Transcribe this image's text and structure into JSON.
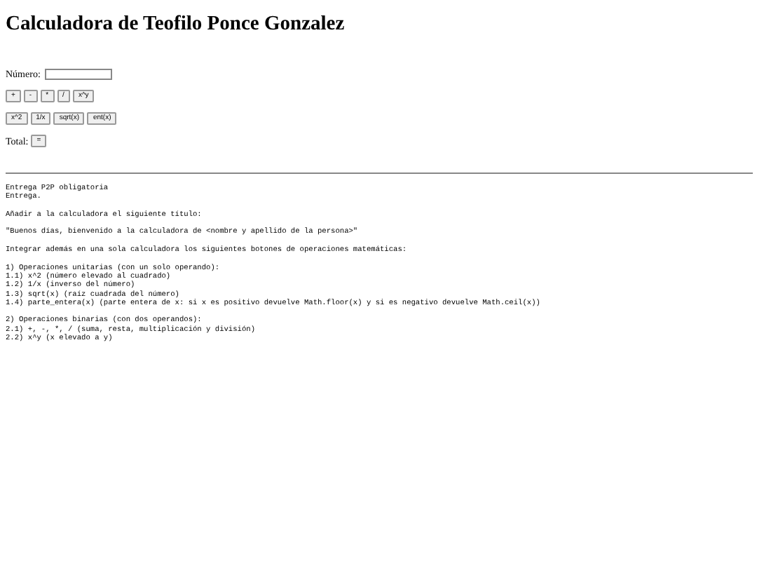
{
  "title": "Calculadora de Teofilo Ponce Gonzalez",
  "number_label": "Número:",
  "binary_buttons": [
    "+",
    "-",
    "*",
    "/",
    "x^y"
  ],
  "unary_buttons": [
    "x^2",
    "1/x",
    "sqrt(x)",
    "ent(x)"
  ],
  "total_label": "Total:",
  "equals_button": "=",
  "instructions": [
    [
      "Entrega P2P obligatoria",
      "Entrega."
    ],
    [
      "Añadir a la calculadora el siguiente título:"
    ],
    [
      "\"Buenos días, bienvenido a la calculadora de <nombre y apellido de la persona>\""
    ],
    [
      "Integrar además en una sola calculadora los siguientes botones de operaciones matemáticas:"
    ],
    [
      "1) Operaciones unitarias (con un solo operando):",
      "1.1) x^2 (número elevado al cuadrado)",
      "1.2) 1/x (inverso del número)",
      "1.3) sqrt(x) (raíz cuadrada del número)",
      "1.4) parte_entera(x) (parte entera de x: si x es positivo devuelve Math.floor(x) y si es negativo devuelve Math.ceil(x))"
    ],
    [
      "2) Operaciones binarias (con dos operandos):",
      "2.1) +, -, *, / (suma, resta, multiplicación y división)",
      "2.2) x^y (x elevado a y)"
    ]
  ]
}
